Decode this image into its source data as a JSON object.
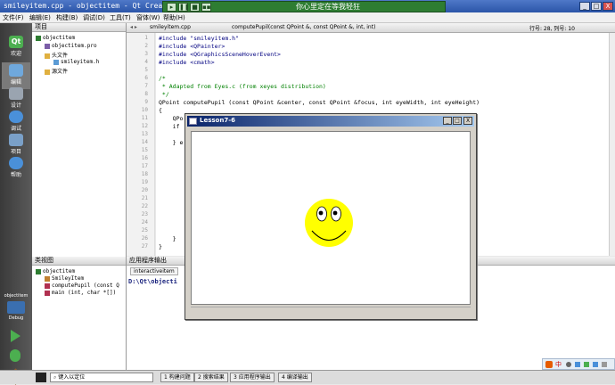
{
  "window": {
    "title": "smileyitem.cpp - objectitem - Qt Creator",
    "min": "_",
    "max": "□",
    "close": "X"
  },
  "player": {
    "lyric": "你心里定在等我轻狂",
    "buttons": [
      "▸",
      "❚❚",
      "■",
      "▪▪"
    ]
  },
  "menu": [
    "文件(F)",
    "编辑(E)",
    "构建(B)",
    "调试(D)",
    "工具(T)",
    "窗体(W)",
    "帮助(H)"
  ],
  "modes": [
    {
      "label": "欢迎",
      "color": "#4caf50"
    },
    {
      "label": "编辑",
      "color": "#6fa8dc"
    },
    {
      "label": "设计",
      "color": "#9aa4b0"
    },
    {
      "label": "调试",
      "color": "#4a90d9"
    },
    {
      "label": "项目",
      "color": "#7aa0c8"
    },
    {
      "label": "帮助",
      "color": "#4a90d9"
    }
  ],
  "kit": {
    "project": "objectitem",
    "build": "Debug"
  },
  "project_panel": {
    "title": "项目",
    "tree": [
      {
        "label": "objectitem",
        "indent": 0,
        "color": "#2e7d32"
      },
      {
        "label": "objectitem.pro",
        "indent": 1,
        "color": "#7b5ea7"
      },
      {
        "label": "头文件",
        "indent": 1,
        "color": "#e0b040"
      },
      {
        "label": "smileyitem.h",
        "indent": 2,
        "color": "#5b9bd5"
      },
      {
        "label": "源文件",
        "indent": 1,
        "color": "#e0b040"
      }
    ]
  },
  "editor": {
    "file": "smileyitem.cpp",
    "function": "computePupil(const QPoint &, const QPoint &, int, int)",
    "position": "行号: 28, 列号: 10",
    "lines": [
      "1",
      "2",
      "3",
      "4",
      "5",
      "6",
      "7",
      "8",
      "9",
      "10",
      "11",
      "12",
      "13",
      "14",
      "15",
      "16",
      "17",
      "18",
      "19",
      "20",
      "21",
      "22",
      "23",
      "24",
      "25",
      "26",
      "27"
    ],
    "code": [
      "#include \"smileyitem.h\"",
      "#include <QPainter>",
      "#include <QGraphicsSceneHoverEvent>",
      "#include <cmath>",
      "",
      "/*",
      " * Adapted from Eyes.c (from xeyes distribution)",
      " */",
      "QPoint computePupil (const QPoint &center, const QPoint &focus, int eyeWidth, int eyeHeight)",
      "{",
      "    QPo",
      "    if",
      "",
      "    } e",
      "",
      "",
      "",
      "",
      "",
      "",
      "",
      "",
      "",
      "",
      "",
      "    }",
      "}"
    ]
  },
  "class_view": {
    "title": "类视图",
    "tree": [
      {
        "label": "objectitem",
        "indent": 0
      },
      {
        "label": "SmileyItem",
        "indent": 1
      },
      {
        "label": "computePupil (const Q",
        "indent": 1
      },
      {
        "label": "main (int, char *[])",
        "indent": 1
      }
    ]
  },
  "output": {
    "title": "应用程序输出",
    "tab": "interactiveitem",
    "text": "D:\\Qt\\objecti"
  },
  "dialog": {
    "title": "Lesson7-6",
    "min": "_",
    "max": "□",
    "close": "X"
  },
  "status": {
    "locate": "键入以定位",
    "tabs": [
      "1 构建问题",
      "2 搜索结果",
      "3 应用程序输出",
      "4 编译输出"
    ]
  }
}
